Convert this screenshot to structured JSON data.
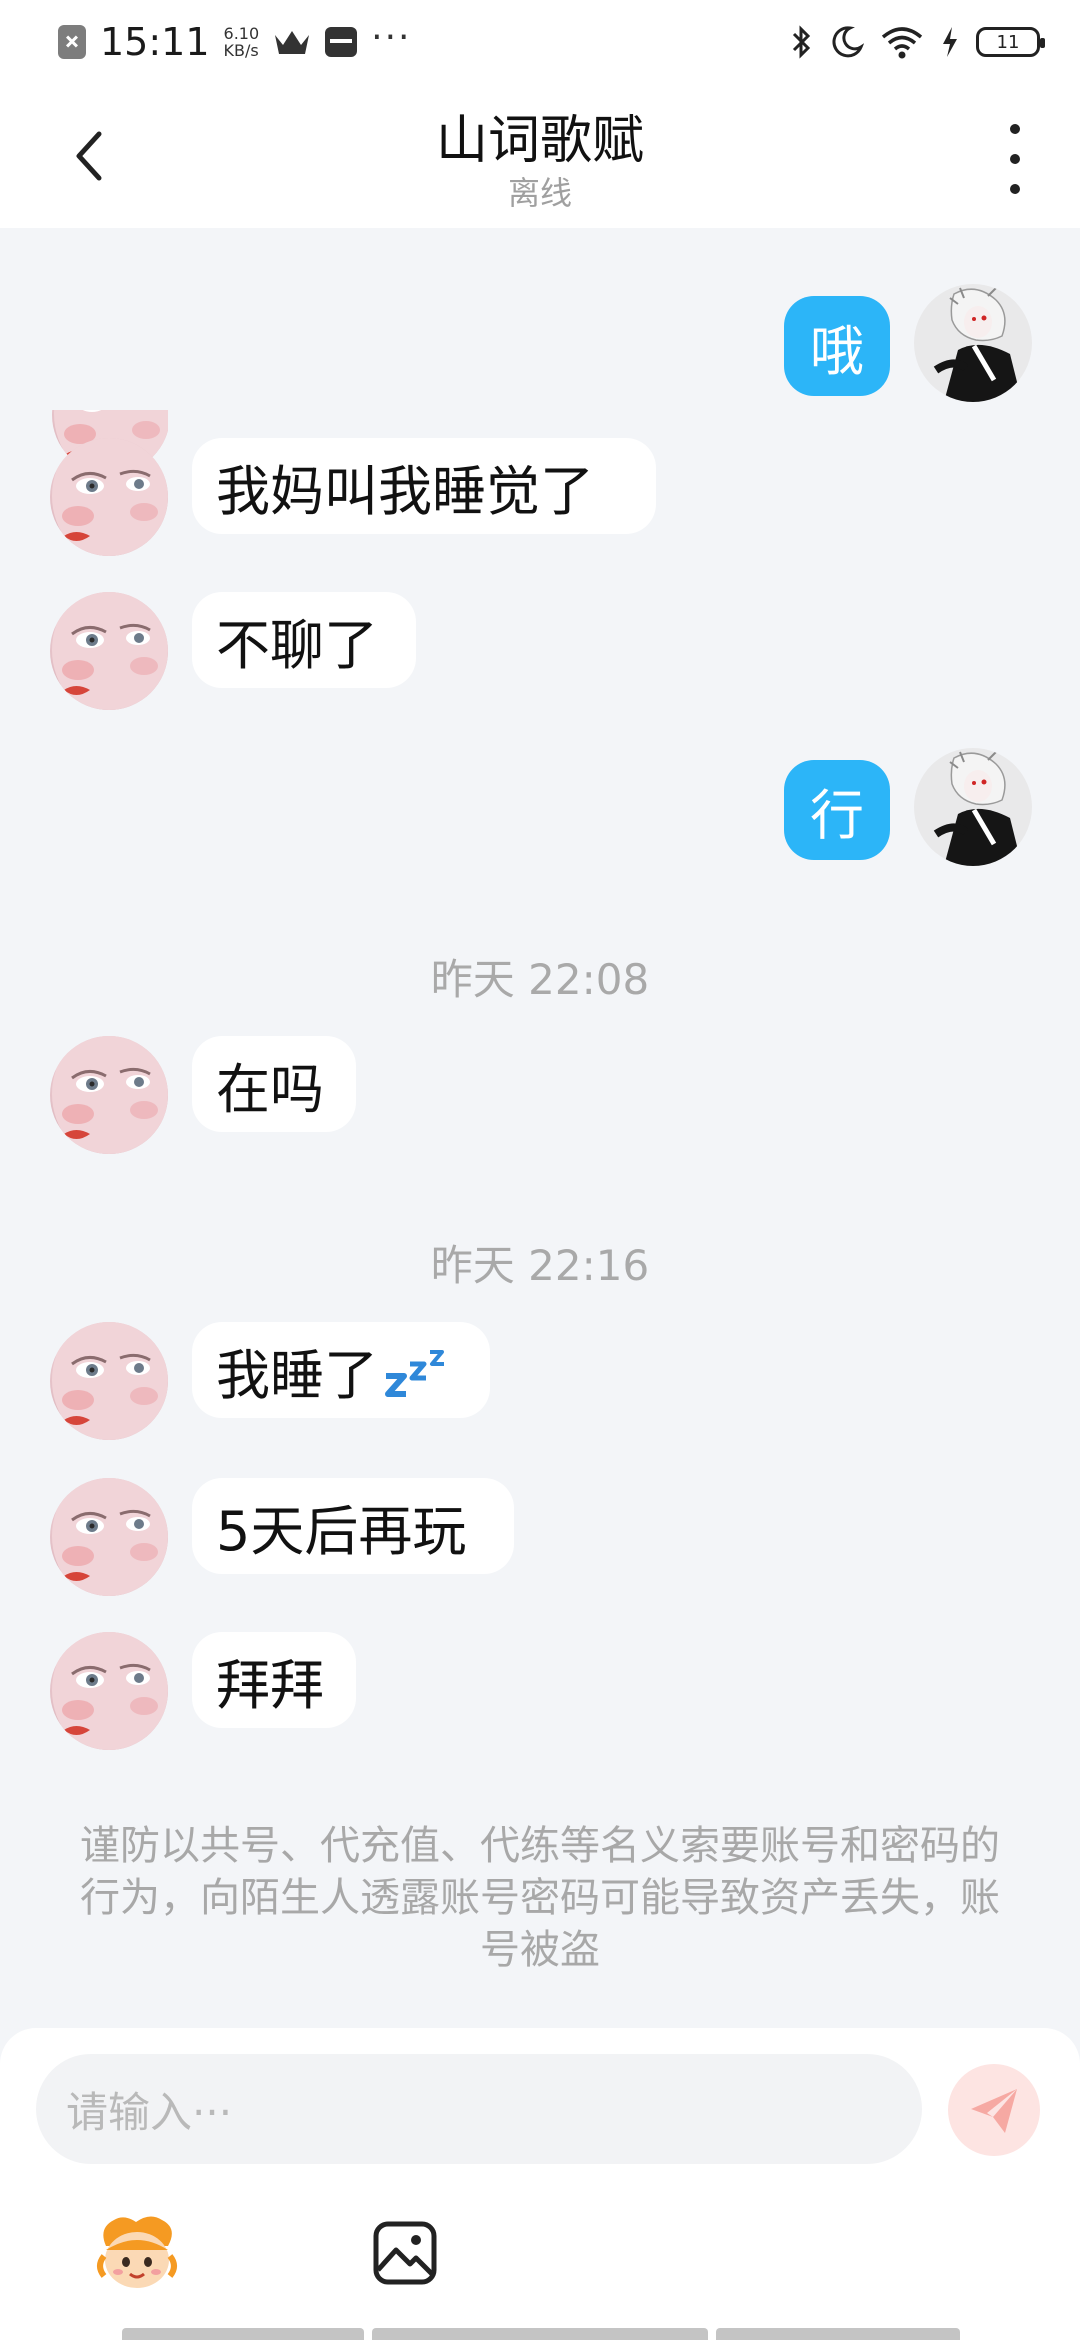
{
  "status_bar": {
    "time": "15:11",
    "net_speed_value": "6.10",
    "net_speed_unit": "KB/s",
    "more_glyph": "···",
    "battery_level": "11"
  },
  "header": {
    "title": "山词歌赋",
    "subtitle": "离线"
  },
  "messages": [
    {
      "direction": "out",
      "text": "哦"
    },
    {
      "direction": "in",
      "text": "我妈叫我睡觉了"
    },
    {
      "direction": "in",
      "text": "不聊了"
    },
    {
      "direction": "out",
      "text": "行"
    },
    {
      "timestamp": "昨天 22:08"
    },
    {
      "direction": "in",
      "text": "在吗"
    },
    {
      "timestamp": "昨天 22:16"
    },
    {
      "direction": "in",
      "text": "我睡了",
      "emoji": "zzz"
    },
    {
      "direction": "in",
      "text": "5天后再玩"
    },
    {
      "direction": "in",
      "text": "拜拜"
    }
  ],
  "warning": "谨防以共号、代充值、代练等名义索要账号和密码的行为，向陌生人透露账号密码可能导致资产丢失，账号被盗",
  "input": {
    "placeholder": "请输入···"
  },
  "icons": {
    "back": "back-arrow-icon",
    "more": "more-vertical-icon",
    "send": "paper-plane-icon",
    "emoji": "mascot-emoji-icon",
    "image": "image-icon"
  },
  "colors": {
    "outgoing_bubble": "#2cb5f8",
    "incoming_bubble": "#ffffff",
    "background": "#f3f5f8",
    "send_button": "#f6a9a3"
  }
}
